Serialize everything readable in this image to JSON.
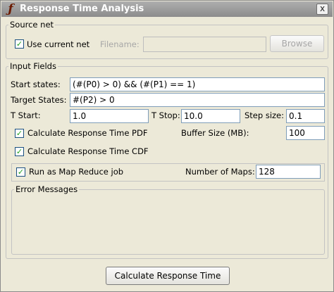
{
  "window": {
    "title": "Response Time Analysis",
    "close_glyph": "x",
    "icon": "petri-net-logo-icon"
  },
  "source_net": {
    "legend": "Source net",
    "use_current_net_label": "Use current net",
    "use_current_net_checked": true,
    "filename_label": "Filename:",
    "filename_value": "",
    "browse_label": "Browse"
  },
  "input_fields": {
    "legend": "Input Fields",
    "start_states_label": "Start states:",
    "start_states_value": "(#(P0) > 0) && (#(P1) == 1)",
    "target_states_label": "Target States:",
    "target_states_value": "#(P2) > 0",
    "t_start_label": "T Start:",
    "t_start_value": "1.0",
    "t_stop_label": "T Stop:",
    "t_stop_value": "10.0",
    "step_size_label": "Step size:",
    "step_size_value": "0.1",
    "calc_pdf_label": "Calculate Response Time PDF",
    "calc_pdf_checked": true,
    "buffer_size_label": "Buffer Size (MB):",
    "buffer_size_value": "100",
    "calc_cdf_label": "Calculate Response Time CDF",
    "calc_cdf_checked": true,
    "map_reduce_label": "Run as Map Reduce job",
    "map_reduce_checked": true,
    "num_maps_label": "Number of Maps:",
    "num_maps_value": "128",
    "error_messages_legend": "Error Messages",
    "error_messages_text": ""
  },
  "actions": {
    "calculate_label": "Calculate Response Time"
  },
  "check_glyph": "✓"
}
